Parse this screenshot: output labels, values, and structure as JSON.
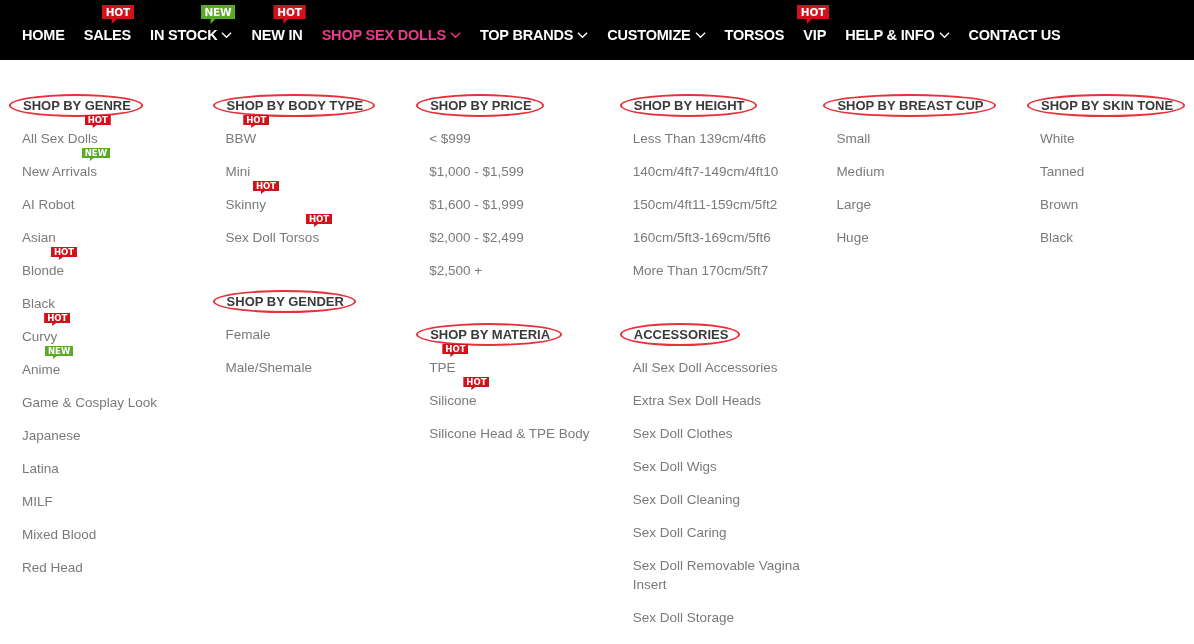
{
  "nav": [
    {
      "label": "HOME",
      "dropdown": false,
      "selected": false
    },
    {
      "label": "SALES",
      "dropdown": false,
      "selected": false,
      "badge": {
        "text": "HOT",
        "kind": "hot"
      }
    },
    {
      "label": "IN STOCK",
      "dropdown": true,
      "selected": false,
      "badge": {
        "text": "NEW",
        "kind": "new"
      }
    },
    {
      "label": "NEW IN",
      "dropdown": false,
      "selected": false,
      "badge": {
        "text": "HOT",
        "kind": "hot"
      }
    },
    {
      "label": "SHOP SEX DOLLS",
      "dropdown": true,
      "selected": true
    },
    {
      "label": "TOP BRANDS",
      "dropdown": true,
      "selected": false
    },
    {
      "label": "CUSTOMIZE",
      "dropdown": true,
      "selected": false
    },
    {
      "label": "TORSOS",
      "dropdown": false,
      "selected": false
    },
    {
      "label": "VIP",
      "dropdown": false,
      "selected": false,
      "badge": {
        "text": "HOT",
        "kind": "hot"
      }
    },
    {
      "label": "HELP & INFO",
      "dropdown": true,
      "selected": false
    },
    {
      "label": "CONTACT US",
      "dropdown": false,
      "selected": false
    }
  ],
  "columns": [
    {
      "groups": [
        {
          "title": "SHOP BY GENRE",
          "items": [
            {
              "label": "All Sex Dolls",
              "badge": {
                "text": "HOT",
                "kind": "hot"
              }
            },
            {
              "label": "New Arrivals",
              "badge": {
                "text": "NEW",
                "kind": "new"
              }
            },
            {
              "label": "AI Robot"
            },
            {
              "label": "Asian"
            },
            {
              "label": "Blonde",
              "badge": {
                "text": "HOT",
                "kind": "hot"
              }
            },
            {
              "label": "Black"
            },
            {
              "label": "Curvy",
              "badge": {
                "text": "HOT",
                "kind": "hot"
              }
            },
            {
              "label": "Anime",
              "badge": {
                "text": "NEW",
                "kind": "new"
              }
            },
            {
              "label": "Game & Cosplay Look"
            },
            {
              "label": "Japanese"
            },
            {
              "label": "Latina"
            },
            {
              "label": "MILF"
            },
            {
              "label": "Mixed Blood"
            },
            {
              "label": "Red Head"
            }
          ]
        }
      ]
    },
    {
      "groups": [
        {
          "title": "SHOP BY BODY TYPE",
          "items": [
            {
              "label": "BBW",
              "badge": {
                "text": "HOT",
                "kind": "hot"
              }
            },
            {
              "label": "Mini"
            },
            {
              "label": "Skinny",
              "badge": {
                "text": "HOT",
                "kind": "hot"
              }
            },
            {
              "label": "Sex Doll Torsos",
              "badge": {
                "text": "HOT",
                "kind": "hot"
              }
            }
          ]
        },
        {
          "title": "SHOP BY GENDER",
          "items": [
            {
              "label": "Female"
            },
            {
              "label": "Male/Shemale"
            }
          ]
        }
      ]
    },
    {
      "groups": [
        {
          "title": "SHOP BY PRICE",
          "items": [
            {
              "label": "< $999"
            },
            {
              "label": "$1,000 - $1,599"
            },
            {
              "label": "$1,600 - $1,999"
            },
            {
              "label": "$2,000 - $2,499"
            },
            {
              "label": "$2,500 +"
            }
          ]
        },
        {
          "title": "SHOP BY MATERIA",
          "items": [
            {
              "label": "TPE",
              "badge": {
                "text": "HOT",
                "kind": "hot"
              }
            },
            {
              "label": "Silicone",
              "badge": {
                "text": "HOT",
                "kind": "hot"
              }
            },
            {
              "label": "Silicone Head & TPE Body"
            }
          ]
        }
      ]
    },
    {
      "groups": [
        {
          "title": "SHOP BY HEIGHT",
          "items": [
            {
              "label": "Less Than 139cm/4ft6"
            },
            {
              "label": "140cm/4ft7-149cm/4ft10"
            },
            {
              "label": "150cm/4ft11-159cm/5ft2"
            },
            {
              "label": "160cm/5ft3-169cm/5ft6"
            },
            {
              "label": "More Than 170cm/5ft7"
            }
          ]
        },
        {
          "title": "ACCESSORIES",
          "items": [
            {
              "label": "All Sex Doll Accessories"
            },
            {
              "label": "Extra Sex Doll Heads"
            },
            {
              "label": "Sex Doll Clothes"
            },
            {
              "label": "Sex Doll Wigs"
            },
            {
              "label": "Sex Doll Cleaning"
            },
            {
              "label": "Sex Doll Caring"
            },
            {
              "label": "Sex Doll Removable Vagina Insert"
            },
            {
              "label": "Sex Doll Storage"
            }
          ]
        }
      ]
    },
    {
      "groups": [
        {
          "title": "SHOP BY BREAST CUP",
          "items": [
            {
              "label": "Small"
            },
            {
              "label": "Medium"
            },
            {
              "label": "Large"
            },
            {
              "label": "Huge"
            }
          ]
        }
      ]
    },
    {
      "groups": [
        {
          "title": "SHOP BY SKIN TONE",
          "items": [
            {
              "label": "White"
            },
            {
              "label": "Tanned"
            },
            {
              "label": "Brown"
            },
            {
              "label": "Black"
            }
          ]
        }
      ]
    }
  ]
}
